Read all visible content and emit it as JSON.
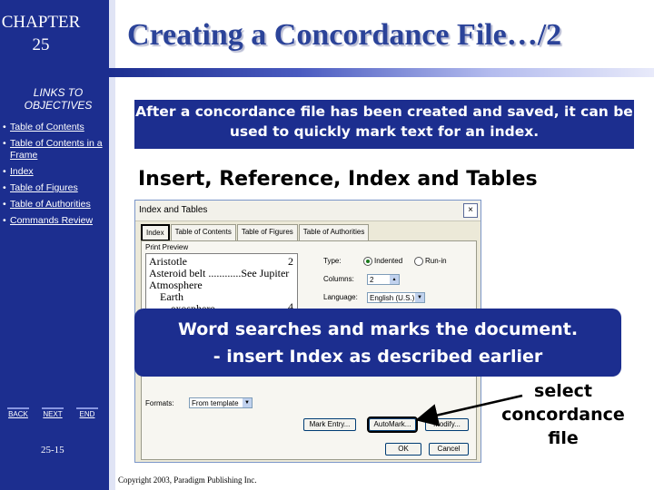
{
  "sidebar": {
    "chapter_line1": "CHAPTER",
    "chapter_line2": "25",
    "links_title": "LINKS TO OBJECTIVES",
    "items": [
      {
        "label": "Table of Contents"
      },
      {
        "label": "Table of Contents in a Frame"
      },
      {
        "label": "Index"
      },
      {
        "label": "Table of Figures"
      },
      {
        "label": "Table of Authorities"
      },
      {
        "label": "Commands Review"
      }
    ],
    "buttons": {
      "back": "BACK",
      "next": "NEXT",
      "end": "END"
    },
    "page_number": "25-15"
  },
  "slide": {
    "title": "Creating a Concordance File…/2",
    "intro": "After a concordance file has been created and saved, it can be used to quickly mark text for an index.",
    "heading": "Insert, Reference, Index and Tables",
    "callout_line1": "Word searches and marks the document.",
    "callout_line2": "- insert Index as described earlier",
    "note": "select concordance file",
    "copyright": "Copyright 2003, Paradigm Publishing Inc."
  },
  "dialog": {
    "title": "Index and Tables",
    "close": "×",
    "tabs": [
      "Index",
      "Table of Contents",
      "Table of Figures",
      "Table of Authorities"
    ],
    "print_preview_label": "Print Preview",
    "preview": {
      "aristotle": "Aristotle",
      "aristotle_page": "2",
      "asteroid": "Asteroid belt ............See Jupiter",
      "atmosphere": "Atmosphere",
      "earth": "Earth",
      "exosphere": "exosphere",
      "exosphere_page": "4"
    },
    "type_label": "Type:",
    "type_indented": "Indented",
    "type_runin": "Run-in",
    "columns_label": "Columns:",
    "columns_value": "2",
    "language_label": "Language:",
    "language_value": "English (U.S.)",
    "formats_label": "Formats:",
    "formats_value": "From template",
    "buttons": {
      "mark_entry": "Mark Entry...",
      "automark": "AutoMark...",
      "modify": "Modify...",
      "ok": "OK",
      "cancel": "Cancel"
    }
  },
  "colors": {
    "navy": "#1c2e8f",
    "title_blue": "#2b4399"
  }
}
